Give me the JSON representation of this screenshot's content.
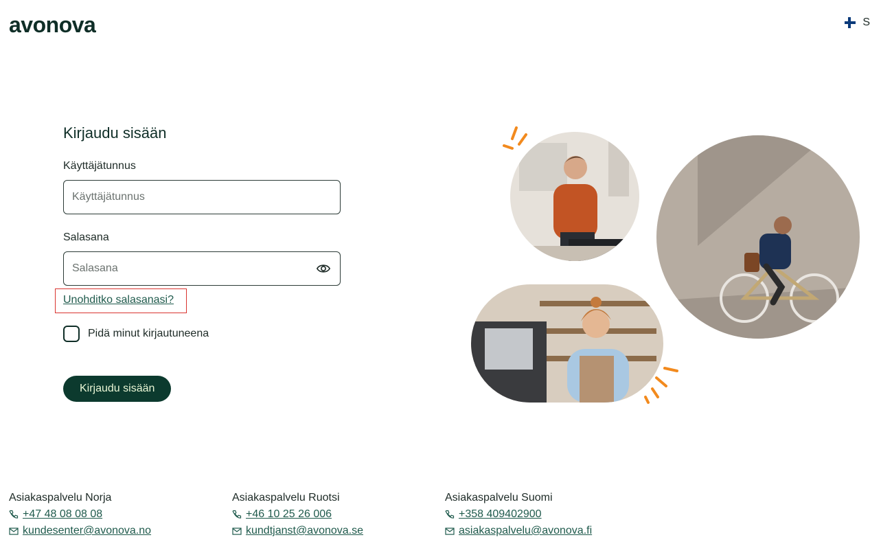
{
  "header": {
    "logo": "avonova",
    "language": "S"
  },
  "login": {
    "title": "Kirjaudu sisään",
    "username_label": "Käyttäjätunnus",
    "username_placeholder": "Käyttäjätunnus",
    "username_value": "",
    "password_label": "Salasana",
    "password_placeholder": "Salasana",
    "password_value": "",
    "forgot_link": "Unohditko salasanasi?",
    "remember_label": "Pidä minut kirjautuneena",
    "remember_checked": false,
    "submit_label": "Kirjaudu sisään"
  },
  "footer": {
    "columns": [
      {
        "title": "Asiakaspalvelu Norja",
        "phone": "+47 48 08 08 08",
        "email": "kundesenter@avonova.no"
      },
      {
        "title": "Asiakaspalvelu Ruotsi",
        "phone": "+46 10 25 26 006",
        "email": "kundtjanst@avonova.se"
      },
      {
        "title": "Asiakaspalvelu Suomi",
        "phone": "+358 409402900",
        "email": "asiakaspalvelu@avonova.fi"
      }
    ]
  },
  "colors": {
    "brand_dark": "#0c3a2e",
    "link": "#1f5a4c",
    "accent_orange": "#f28a1e",
    "highlight_red": "#d9332e"
  },
  "icons": [
    "flag-icon",
    "eye-icon",
    "phone-icon",
    "mail-icon"
  ]
}
